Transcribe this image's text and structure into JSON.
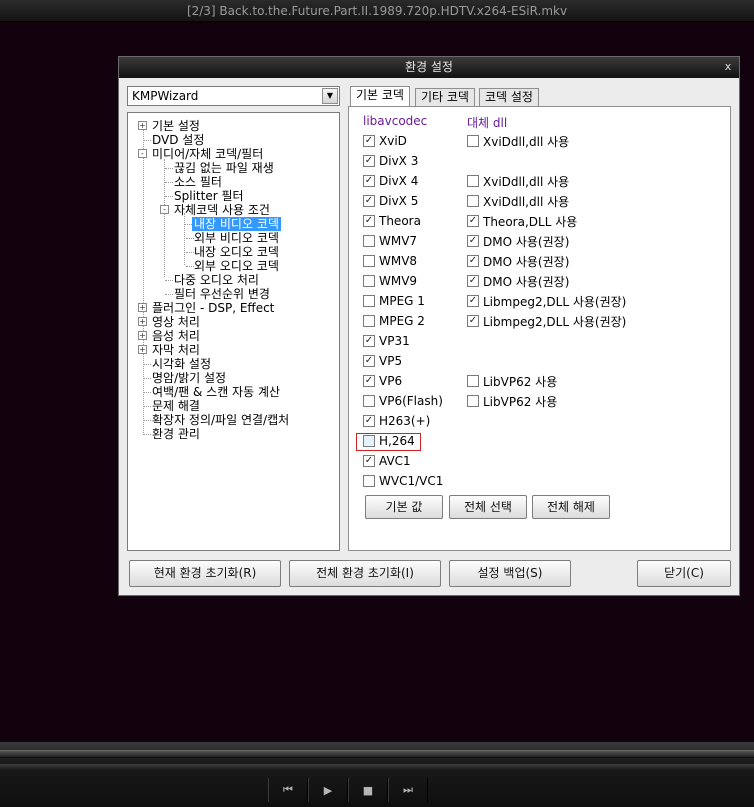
{
  "player": {
    "title": "[2/3] Back.to.the.Future.Part.II.1989.720p.HDTV.x264-ESiR.mkv",
    "controls": [
      {
        "name": "prev-icon",
        "glyph": "⏮"
      },
      {
        "name": "play-icon",
        "glyph": "▶"
      },
      {
        "name": "stop-icon",
        "glyph": "■"
      },
      {
        "name": "next-icon",
        "glyph": "⏭"
      }
    ]
  },
  "dialog": {
    "title": "환경 설정",
    "close": "x",
    "preset": "KMPWizard"
  },
  "tree": [
    {
      "label": "기본 설정",
      "expander": "+"
    },
    {
      "label": "DVD 설정"
    },
    {
      "label": "미디어/자체 코덱/필터",
      "expander": "-"
    },
    {
      "label": "끊김 없는 파일 재생"
    },
    {
      "label": "소스 필터"
    },
    {
      "label": "Splitter 필터"
    },
    {
      "label": "자체코덱 사용 조건",
      "expander": "-"
    },
    {
      "label": "내장 비디오 코덱",
      "selected": true
    },
    {
      "label": "외부 비디오 코덱"
    },
    {
      "label": "내장 오디오 코덱"
    },
    {
      "label": "외부 오디오 코덱"
    },
    {
      "label": "다중 오디오 처리"
    },
    {
      "label": "필터 우선순위 변경"
    },
    {
      "label": "플러그인 - DSP, Effect",
      "expander": "+"
    },
    {
      "label": "영상 처리",
      "expander": "+"
    },
    {
      "label": "음성 처리",
      "expander": "+"
    },
    {
      "label": "자막 처리",
      "expander": "+"
    },
    {
      "label": "시각화 설정"
    },
    {
      "label": "명암/밝기 설정"
    },
    {
      "label": "여백/팬 & 스캔 자동 계산"
    },
    {
      "label": "문제 해결"
    },
    {
      "label": "확장자 정의/파일 연결/캡처"
    },
    {
      "label": "환경 관리"
    }
  ],
  "tabs": [
    {
      "label": "기본 코덱",
      "active": true
    },
    {
      "label": "기타 코덱",
      "active": false
    },
    {
      "label": "코덱 설정",
      "active": false
    }
  ],
  "codec_panel": {
    "left_header": "libavcodec",
    "right_header": "대체 dll",
    "rows": [
      {
        "codec": "XviD",
        "checked": true,
        "alt": "XviDdll,dll 사용",
        "alt_checked": false
      },
      {
        "codec": "DivX 3",
        "checked": true
      },
      {
        "codec": "DivX 4",
        "checked": true,
        "alt": "XviDdll,dll 사용",
        "alt_checked": false
      },
      {
        "codec": "DivX 5",
        "checked": true,
        "alt": "XviDdll,dll 사용",
        "alt_checked": false
      },
      {
        "codec": "Theora",
        "checked": true,
        "alt": "Theora,DLL 사용",
        "alt_checked": true
      },
      {
        "codec": "WMV7",
        "checked": false,
        "alt": "DMO 사용(권장)",
        "alt_checked": true
      },
      {
        "codec": "WMV8",
        "checked": false,
        "alt": "DMO 사용(권장)",
        "alt_checked": true
      },
      {
        "codec": "WMV9",
        "checked": false,
        "alt": "DMO 사용(권장)",
        "alt_checked": true
      },
      {
        "codec": "MPEG 1",
        "checked": false,
        "alt": "Libmpeg2,DLL 사용(권장)",
        "alt_checked": true
      },
      {
        "codec": "MPEG 2",
        "checked": false,
        "alt": "Libmpeg2,DLL 사용(권장)",
        "alt_checked": true
      },
      {
        "codec": "VP31",
        "checked": true
      },
      {
        "codec": "VP5",
        "checked": true
      },
      {
        "codec": "VP6",
        "checked": true,
        "alt": "LibVP62 사용",
        "alt_checked": false
      },
      {
        "codec": "VP6(Flash)",
        "checked": false,
        "alt": "LibVP62 사용",
        "alt_checked": false
      },
      {
        "codec": "H263(+)",
        "checked": true
      },
      {
        "codec": "H,264",
        "checked": false,
        "highlighted": true
      },
      {
        "codec": "AVC1",
        "checked": true
      },
      {
        "codec": "WVC1/VC1",
        "checked": false
      }
    ],
    "buttons": [
      "기본 값",
      "전체 선택",
      "전체 해제"
    ]
  },
  "footer_buttons": [
    "현재 환경 초기화(R)",
    "전체 환경 초기화(I)",
    "설정 백업(S)",
    "닫기(C)"
  ],
  "colors": {
    "selection": "#3399ff",
    "header_purple": "#6a1b9a",
    "highlight_red": "#d32222"
  }
}
